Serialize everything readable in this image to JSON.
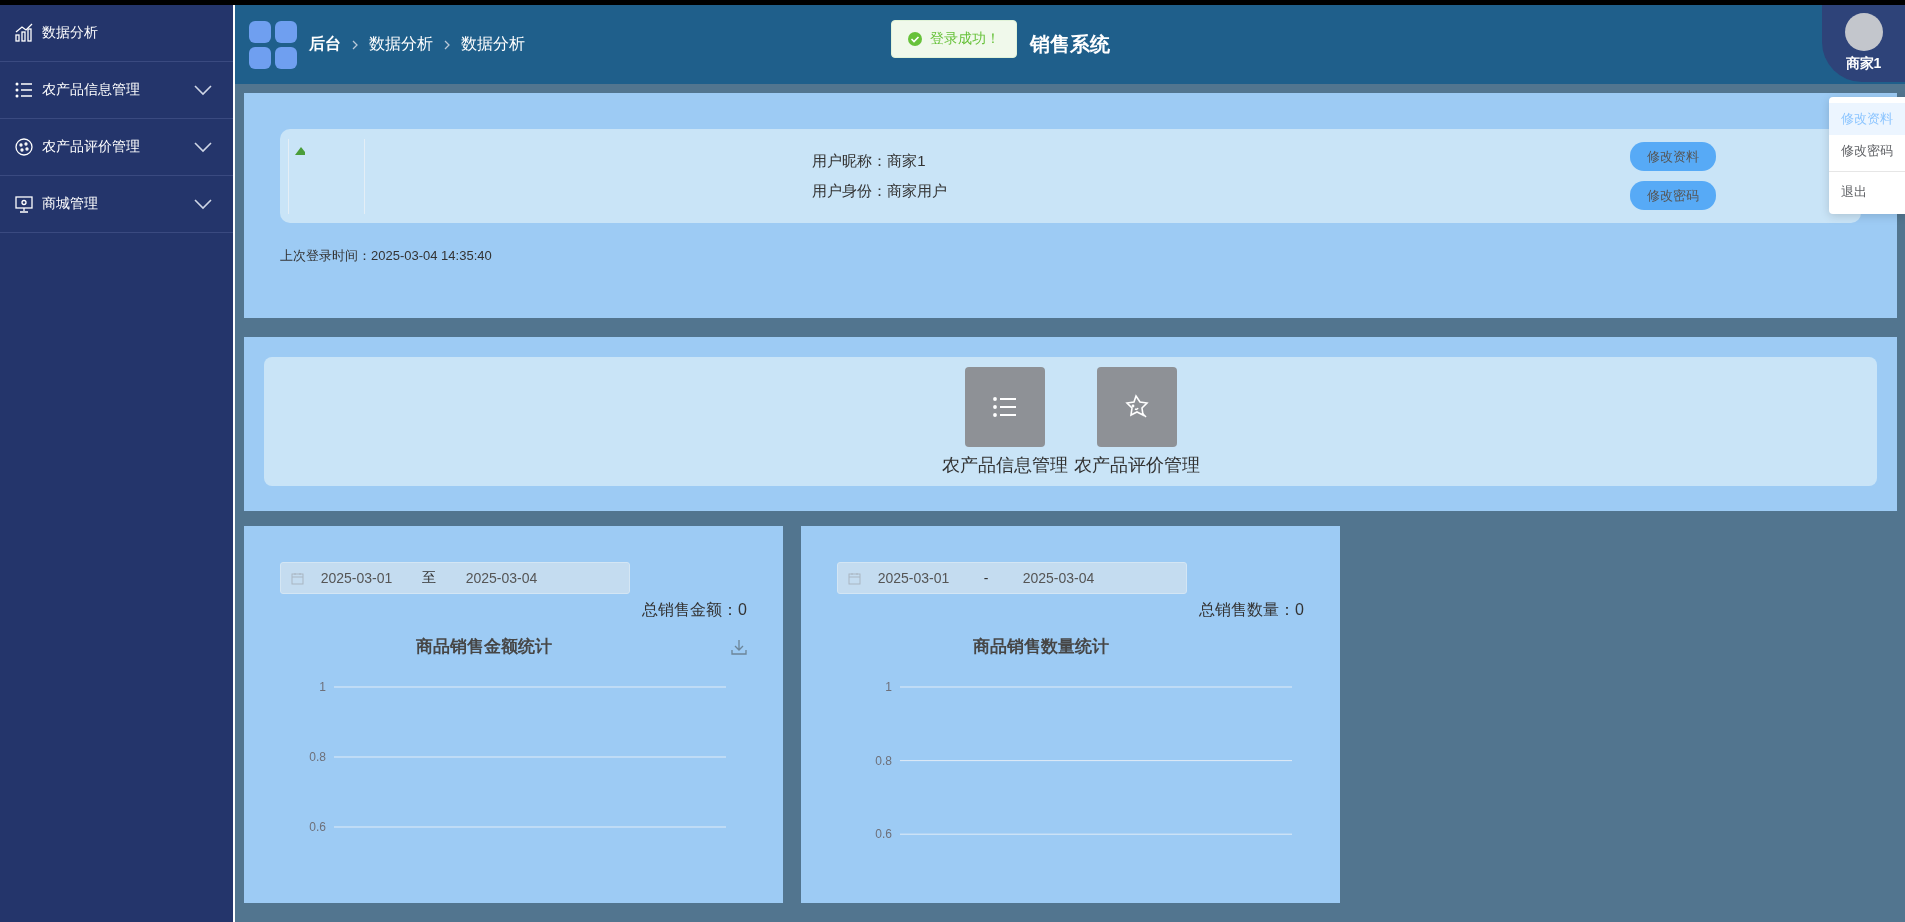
{
  "sidebar": {
    "items": [
      {
        "label": "数据分析",
        "kind": "link"
      },
      {
        "label": "农产品信息管理",
        "kind": "group",
        "expanded": false
      },
      {
        "label": "农产品评价管理",
        "kind": "group",
        "expanded": false
      },
      {
        "label": "商城管理",
        "kind": "group",
        "expanded": false
      }
    ]
  },
  "header": {
    "breadcrumb": [
      "后台",
      "数据分析",
      "数据分析"
    ],
    "title": "销售系统",
    "user": {
      "name": "商家1"
    }
  },
  "toast": {
    "kind": "success",
    "message": "登录成功！"
  },
  "user_menu": {
    "items": [
      {
        "label": "修改资料",
        "hovered": true
      },
      {
        "label": "修改密码",
        "hovered": false
      },
      {
        "label": "退出",
        "hovered": false
      }
    ]
  },
  "profile": {
    "fields": [
      "用户昵称：商家1",
      "用户身份：商家用户"
    ],
    "buttons": [
      "修改资料",
      "修改密码"
    ],
    "last_login": "上次登录时间：2025-03-04 14:35:40"
  },
  "shortcuts": [
    {
      "label": "农产品信息管理"
    },
    {
      "label": "农产品评价管理"
    }
  ],
  "charts": [
    {
      "date_start": "2025-03-01",
      "separator": "至",
      "date_end": "2025-03-04",
      "total": "总销售金额：0",
      "download": true,
      "chart": {
        "title": "商品销售金额统计",
        "y_labels": [
          "1",
          "0.8",
          "0.6"
        ]
      }
    },
    {
      "date_start": "2025-03-01",
      "separator": "-",
      "date_end": "2025-03-04",
      "total": "总销售数量：0",
      "download": false,
      "chart": {
        "title": "商品销售数量统计",
        "y_labels": [
          "1",
          "0.8",
          "0.6"
        ]
      }
    }
  ]
}
